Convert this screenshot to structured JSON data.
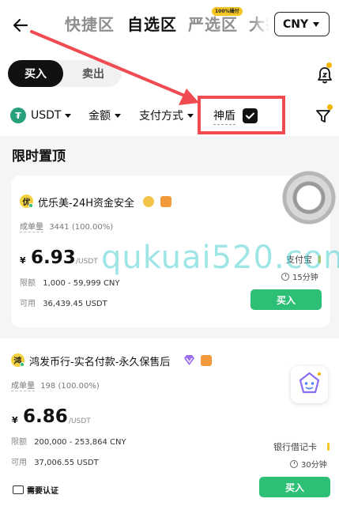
{
  "nav": {
    "back_icon": "arrow-left-icon",
    "tabs": [
      {
        "label": "快捷区",
        "active": false
      },
      {
        "label": "自选区",
        "active": true
      },
      {
        "label": "严选区",
        "active": false,
        "badge": "100%撮付"
      },
      {
        "label": "大宗",
        "active": false
      }
    ],
    "currency": "CNY"
  },
  "trade_toggle": {
    "buy": "买入",
    "sell": "卖出",
    "selected": "买入"
  },
  "notification_icon": "bell-icon",
  "filters": {
    "asset": "USDT",
    "amount": "金额",
    "payment": "支付方式",
    "shield": "神盾",
    "shield_checked": true,
    "filter_icon": "filter-icon"
  },
  "section_title": "限时置顶",
  "ads": [
    {
      "merchant": "优乐美-24H资金安全",
      "avatar_char": "优",
      "volume_label": "成单量",
      "volume": "3441 (100.00%)",
      "currency_symbol": "¥",
      "price": "6.93",
      "unit": "/USDT",
      "limit_label": "限额",
      "limit": "1,000 - 59,999 CNY",
      "available_label": "可用",
      "available": "36,439.45 USDT",
      "payment": "支付宝",
      "time": "15分钟",
      "button": "买入"
    },
    {
      "merchant": "鸿发币行-实名付款-永久保售后",
      "avatar_char": "鸿",
      "volume_label": "成单量",
      "volume": "198 (100.00%)",
      "currency_symbol": "¥",
      "price": "6.86",
      "unit": "/USDT",
      "limit_label": "限额",
      "limit": "200,000 - 253,864 CNY",
      "available_label": "可用",
      "available": "37,006.55 USDT",
      "payment": "银行借记卡",
      "time": "30分钟",
      "button": "买入",
      "verify": "需要认证"
    }
  ],
  "watermark": "qukuai520.com",
  "accent_color": "#2dbf75",
  "annotation_color": "#ef4b50"
}
